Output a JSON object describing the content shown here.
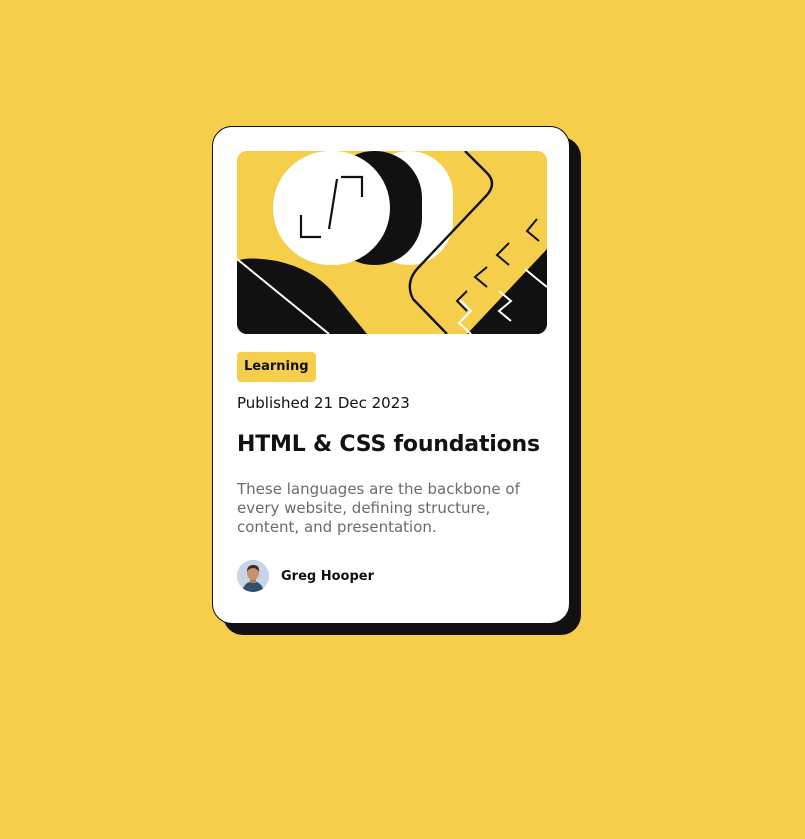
{
  "card": {
    "tag": "Learning",
    "published": "Published 21 Dec 2023",
    "title": "HTML & CSS foundations",
    "description": "These languages are the backbone of every website, defining structure, content, and presentation.",
    "author": {
      "name": "Greg Hooper"
    }
  },
  "colors": {
    "background": "#f5cf4b",
    "card": "#ffffff",
    "ink": "#111111",
    "muted_text": "#6b6b6b"
  },
  "icons": [
    "code-illustration",
    "author-avatar"
  ]
}
